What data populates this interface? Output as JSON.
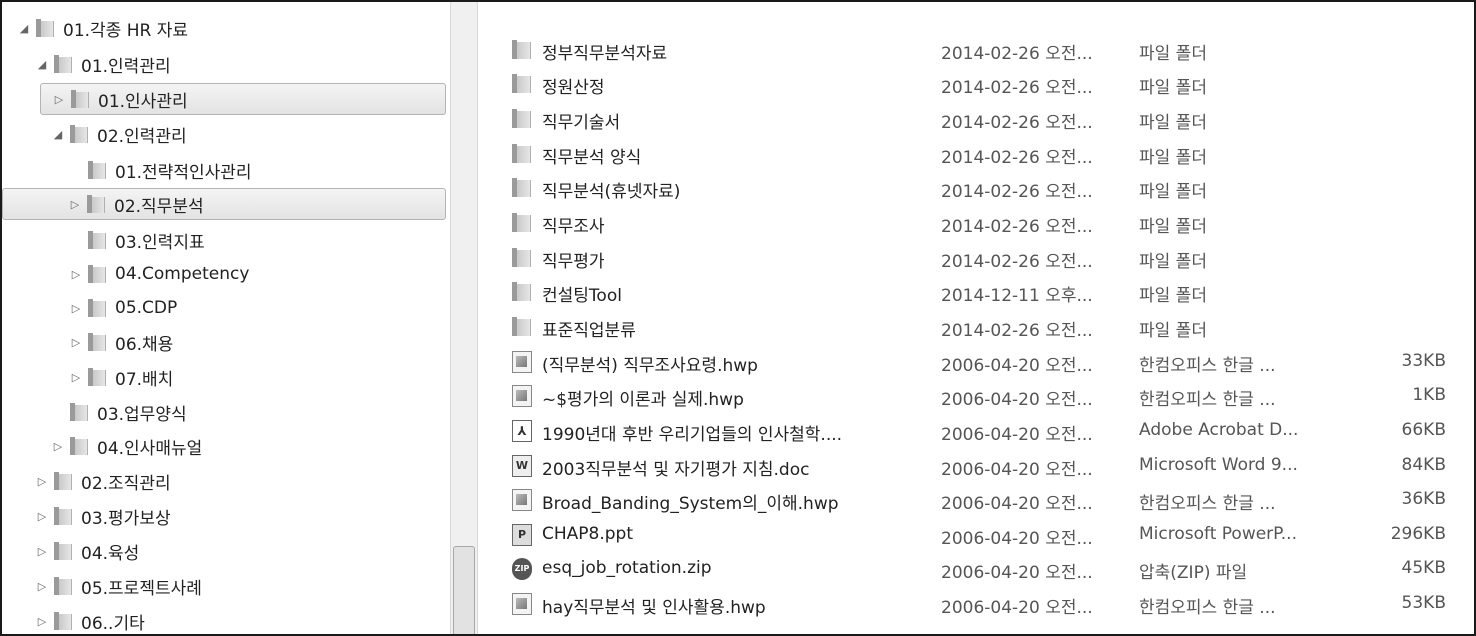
{
  "tree": [
    {
      "label": "01.각종 HR 자료",
      "expander": "◢"
    },
    {
      "label": "01.인력관리",
      "expander": "◢"
    },
    {
      "label": "01.인사관리",
      "expander": "▷"
    },
    {
      "label": "02.인력관리",
      "expander": "◢"
    },
    {
      "label": "01.전략적인사관리",
      "expander": ""
    },
    {
      "label": "02.직무분석",
      "expander": "▷"
    },
    {
      "label": "03.인력지표",
      "expander": ""
    },
    {
      "label": "04.Competency",
      "expander": "▷"
    },
    {
      "label": "05.CDP",
      "expander": "▷"
    },
    {
      "label": "06.채용",
      "expander": "▷"
    },
    {
      "label": "07.배치",
      "expander": "▷"
    },
    {
      "label": "03.업무양식",
      "expander": ""
    },
    {
      "label": "04.인사매뉴얼",
      "expander": "▷"
    },
    {
      "label": "02.조직관리",
      "expander": "▷"
    },
    {
      "label": "03.평가보상",
      "expander": "▷"
    },
    {
      "label": "04.육성",
      "expander": "▷"
    },
    {
      "label": "05.프로젝트사례",
      "expander": "▷"
    },
    {
      "label": "06..기타",
      "expander": "▷"
    }
  ],
  "files": [
    {
      "name": "정부직무분석자료",
      "date": "2014-02-26 오전...",
      "type": "파일 폴더",
      "size": "",
      "icon": "folder-icon"
    },
    {
      "name": "정원산정",
      "date": "2014-02-26 오전...",
      "type": "파일 폴더",
      "size": "",
      "icon": "folder-icon"
    },
    {
      "name": "직무기술서",
      "date": "2014-02-26 오전...",
      "type": "파일 폴더",
      "size": "",
      "icon": "folder-icon"
    },
    {
      "name": "직무분석 양식",
      "date": "2014-02-26 오전...",
      "type": "파일 폴더",
      "size": "",
      "icon": "folder-icon"
    },
    {
      "name": "직무분석(휴넷자료)",
      "date": "2014-02-26 오전...",
      "type": "파일 폴더",
      "size": "",
      "icon": "folder-icon"
    },
    {
      "name": "직무조사",
      "date": "2014-02-26 오전...",
      "type": "파일 폴더",
      "size": "",
      "icon": "folder-icon"
    },
    {
      "name": "직무평가",
      "date": "2014-02-26 오전...",
      "type": "파일 폴더",
      "size": "",
      "icon": "folder-icon"
    },
    {
      "name": "컨설팅Tool",
      "date": "2014-12-11 오후...",
      "type": "파일 폴더",
      "size": "",
      "icon": "folder-icon"
    },
    {
      "name": "표준직업분류",
      "date": "2014-02-26 오전...",
      "type": "파일 폴더",
      "size": "",
      "icon": "folder-icon"
    },
    {
      "name": "(직무분석) 직무조사요령.hwp",
      "date": "2006-04-20 오전...",
      "type": "한컴오피스 한글 ...",
      "size": "33KB",
      "icon": "hwp-file-icon"
    },
    {
      "name": "~$평가의 이론과 실제.hwp",
      "date": "2006-04-20 오전...",
      "type": "한컴오피스 한글 ...",
      "size": "1KB",
      "icon": "hwp-file-icon"
    },
    {
      "name": "1990년대 후반 우리기업들의 인사철학....",
      "date": "2006-04-20 오전...",
      "type": "Adobe Acrobat D...",
      "size": "66KB",
      "icon": "pdf-file-icon"
    },
    {
      "name": "2003직무분석 및 자기평가 지침.doc",
      "date": "2006-04-20 오전...",
      "type": "Microsoft Word 9...",
      "size": "84KB",
      "icon": "word-file-icon"
    },
    {
      "name": "Broad_Banding_System의_이해.hwp",
      "date": "2006-04-20 오전...",
      "type": "한컴오피스 한글 ...",
      "size": "36KB",
      "icon": "hwp-file-icon"
    },
    {
      "name": "CHAP8.ppt",
      "date": "2006-04-20 오전...",
      "type": "Microsoft PowerP...",
      "size": "296KB",
      "icon": "ppt-file-icon"
    },
    {
      "name": "esq_job_rotation.zip",
      "date": "2006-04-20 오전...",
      "type": "압축(ZIP) 파일",
      "size": "45KB",
      "icon": "zip-file-icon"
    },
    {
      "name": "hay직무분석 및 인사활용.hwp",
      "date": "2006-04-20 오전...",
      "type": "한컴오피스 한글 ...",
      "size": "53KB",
      "icon": "hwp-file-icon"
    }
  ]
}
